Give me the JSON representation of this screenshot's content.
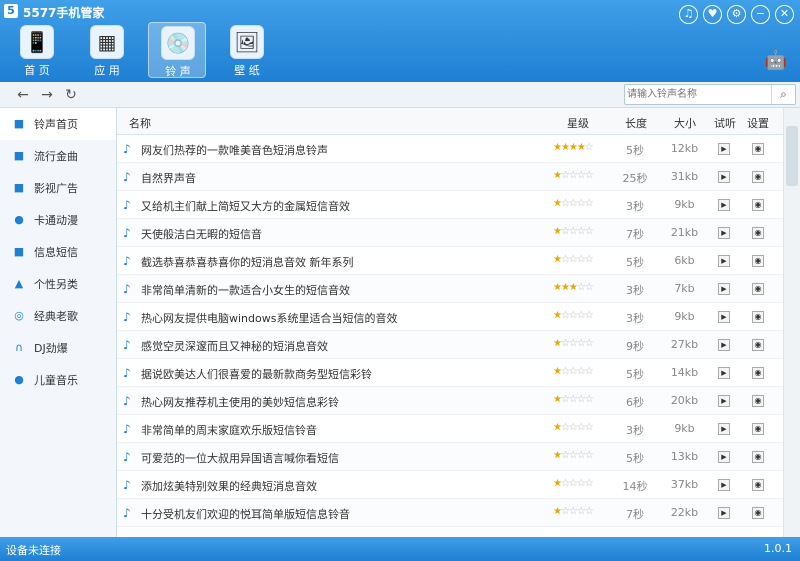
{
  "app": {
    "title": "5577手机管家",
    "logo": "5"
  },
  "window_buttons": [
    "♫",
    "♥",
    "⚙",
    "−",
    "✕"
  ],
  "toolbar": [
    {
      "label": "首 页",
      "icon": "phone-icon",
      "glyph": "📱"
    },
    {
      "label": "应 用",
      "icon": "apps-icon",
      "glyph": "▦"
    },
    {
      "label": "铃 声",
      "icon": "cd-icon",
      "glyph": "💿",
      "active": true
    },
    {
      "label": "壁 纸",
      "icon": "wallpaper-icon",
      "glyph": "🖼"
    }
  ],
  "search": {
    "placeholder": "请输入铃声名称"
  },
  "sidebar": [
    {
      "label": "铃声首页",
      "glyph": "■",
      "active": true
    },
    {
      "label": "流行金曲",
      "glyph": "■"
    },
    {
      "label": "影视广告",
      "glyph": "■"
    },
    {
      "label": "卡通动漫",
      "glyph": "●"
    },
    {
      "label": "信息短信",
      "glyph": "■"
    },
    {
      "label": "个性另类",
      "glyph": "▲"
    },
    {
      "label": "经典老歌",
      "glyph": "◎"
    },
    {
      "label": "DJ劲爆",
      "glyph": "∩"
    },
    {
      "label": "儿童音乐",
      "glyph": "●"
    }
  ],
  "table": {
    "headers": {
      "name": "名称",
      "rating": "星级",
      "length": "长度",
      "size": "大小",
      "listen": "试听",
      "settings": "设置"
    },
    "rows": [
      {
        "name": "网友们热荐的一款唯美音色短消息铃声",
        "stars": 4,
        "length": "5秒",
        "size": "12kb"
      },
      {
        "name": "自然界声音",
        "stars": 1,
        "length": "25秒",
        "size": "31kb"
      },
      {
        "name": "又给机主们献上简短又大方的金属短信音效",
        "stars": 1,
        "length": "3秒",
        "size": "9kb"
      },
      {
        "name": "天使般洁白无暇的短信音",
        "stars": 1,
        "length": "7秒",
        "size": "21kb"
      },
      {
        "name": "截选恭喜恭喜恭喜你的短消息音效 新年系列",
        "stars": 1,
        "length": "5秒",
        "size": "6kb"
      },
      {
        "name": "非常简单清新的一款适合小女生的短信音效",
        "stars": 3,
        "length": "3秒",
        "size": "7kb"
      },
      {
        "name": "热心网友提供电脑windows系统里适合当短信的音效",
        "stars": 1,
        "length": "3秒",
        "size": "9kb"
      },
      {
        "name": "感觉空灵深邃而且又神秘的短消息音效",
        "stars": 1,
        "length": "9秒",
        "size": "27kb"
      },
      {
        "name": "据说欧美达人们很喜爱的最新款商务型短信彩铃",
        "stars": 1,
        "length": "5秒",
        "size": "14kb"
      },
      {
        "name": "热心网友推荐机主使用的美妙短信息彩铃",
        "stars": 1,
        "length": "6秒",
        "size": "20kb"
      },
      {
        "name": "非常简单的周末家庭欢乐版短信铃音",
        "stars": 1,
        "length": "3秒",
        "size": "9kb"
      },
      {
        "name": "可爱范的一位大叔用异国语言喊你看短信",
        "stars": 1,
        "length": "5秒",
        "size": "13kb"
      },
      {
        "name": "添加炫美特别效果的经典短消息音效",
        "stars": 1,
        "length": "14秒",
        "size": "37kb"
      },
      {
        "name": "十分受机友们欢迎的悦耳简单版短信息铃音",
        "stars": 1,
        "length": "7秒",
        "size": "22kb"
      }
    ]
  },
  "status": {
    "left": "设备未连接",
    "right": "1.0.1"
  },
  "colors": {
    "accent": "#1f7fd3",
    "star": "#f2a400"
  }
}
